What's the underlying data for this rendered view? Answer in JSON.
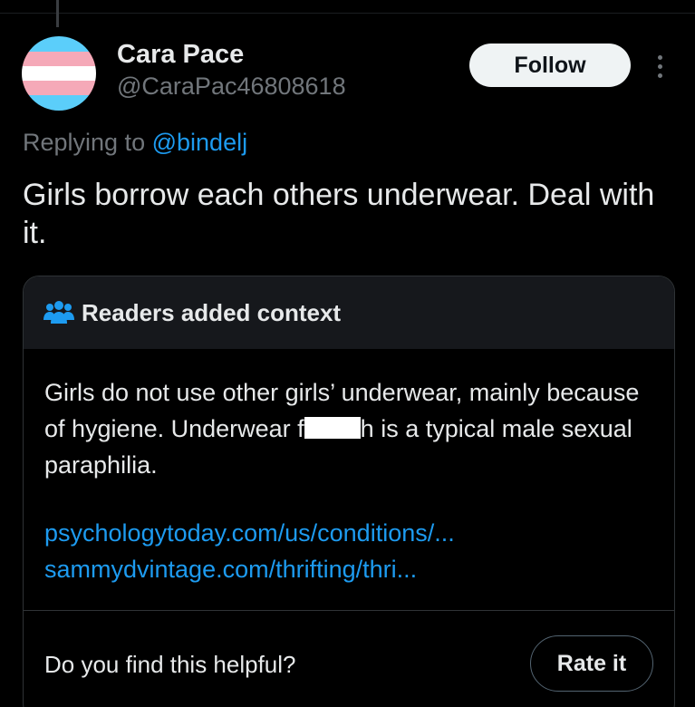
{
  "tweet": {
    "author": {
      "display_name": "Cara Pace",
      "handle": "@CaraPac46808618",
      "avatar_icon": "trans-flag-avatar",
      "avatar_colors": [
        "#5bcefa",
        "#f5a9b8",
        "#ffffff"
      ]
    },
    "follow_label": "Follow",
    "more_icon": "more-options-icon",
    "replying": {
      "prefix": "Replying to",
      "target": "@bindelj"
    },
    "text": "Girls borrow each others underwear. Deal with it."
  },
  "context_note": {
    "icon": "people-icon",
    "title": "Readers added context",
    "body_before_redaction": "Girls do not use other girls’ underwear, mainly because of hygiene. Underwear f",
    "body_after_redaction": "h is a typical male sexual paraphilia.",
    "links": [
      "psychologytoday.com/us/conditions/...",
      "sammydvintage.com/thrifting/thri..."
    ],
    "helpful_question": "Do you find this helpful?",
    "rate_label": "Rate it"
  },
  "colors": {
    "background": "#000000",
    "text": "#e7e9ea",
    "muted": "#71767b",
    "link": "#1d9bf0",
    "border": "#2f3336",
    "card_header": "#16181c"
  }
}
